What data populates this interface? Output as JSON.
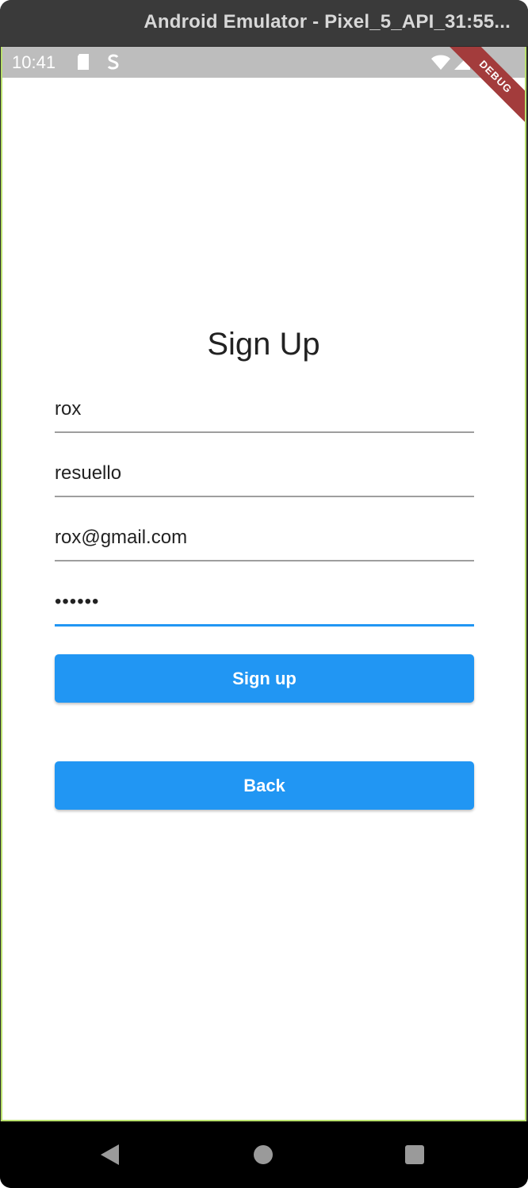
{
  "window": {
    "title": "Android Emulator - Pixel_5_API_31:55..."
  },
  "status_bar": {
    "time": "10:41",
    "icons": [
      "sd-card-icon",
      "media-icon",
      "wifi-icon",
      "signal-icon",
      "battery-icon"
    ]
  },
  "debug_banner": "DEBUG",
  "form": {
    "title": "Sign Up",
    "fields": [
      {
        "name": "first-name",
        "value": "rox"
      },
      {
        "name": "last-name",
        "value": "resuello"
      },
      {
        "name": "email",
        "value": "rox@gmail.com"
      },
      {
        "name": "password",
        "value": "••••••"
      }
    ],
    "signup_label": "Sign up",
    "back_label": "Back"
  },
  "nav_bar": {
    "icons": [
      "back-triangle-icon",
      "home-circle-icon",
      "recents-square-icon"
    ]
  },
  "colors": {
    "primary": "#2196f3",
    "underline": "#9e9e9e",
    "status_bar": "#bdbdbd",
    "debug": "#a33c3c"
  }
}
